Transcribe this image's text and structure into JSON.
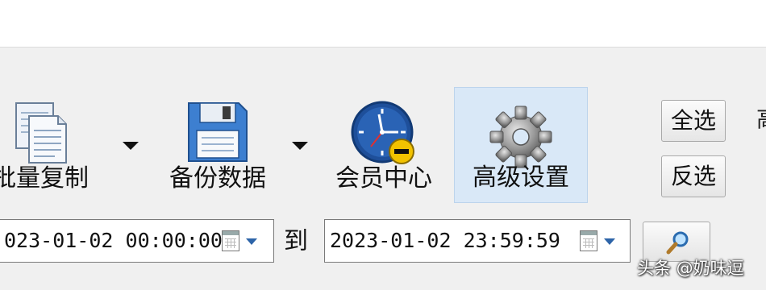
{
  "toolbar": {
    "batch_copy": "批量复制",
    "backup_data": "备份数据",
    "member_center": "会员中心",
    "advanced_settings": "高级设置"
  },
  "side_buttons": {
    "select_all": "全选",
    "invert_select": "反选"
  },
  "edge_glyph": "高",
  "date_range": {
    "start": "023-01-02 00:00:00",
    "separator": "到",
    "end": "2023-01-02 23:59:59"
  },
  "watermark": "头条 @奶味逗",
  "colors": {
    "selected_bg": "#d9e8f7",
    "clock_face": "#1e4f9a",
    "minus_badge": "#f2c200"
  },
  "icons": {
    "batch_copy": "copy-documents-icon",
    "backup_data": "floppy-disk-icon",
    "member_center": "clock-icon",
    "advanced_settings": "gear-icon",
    "search": "magnifier-icon"
  }
}
